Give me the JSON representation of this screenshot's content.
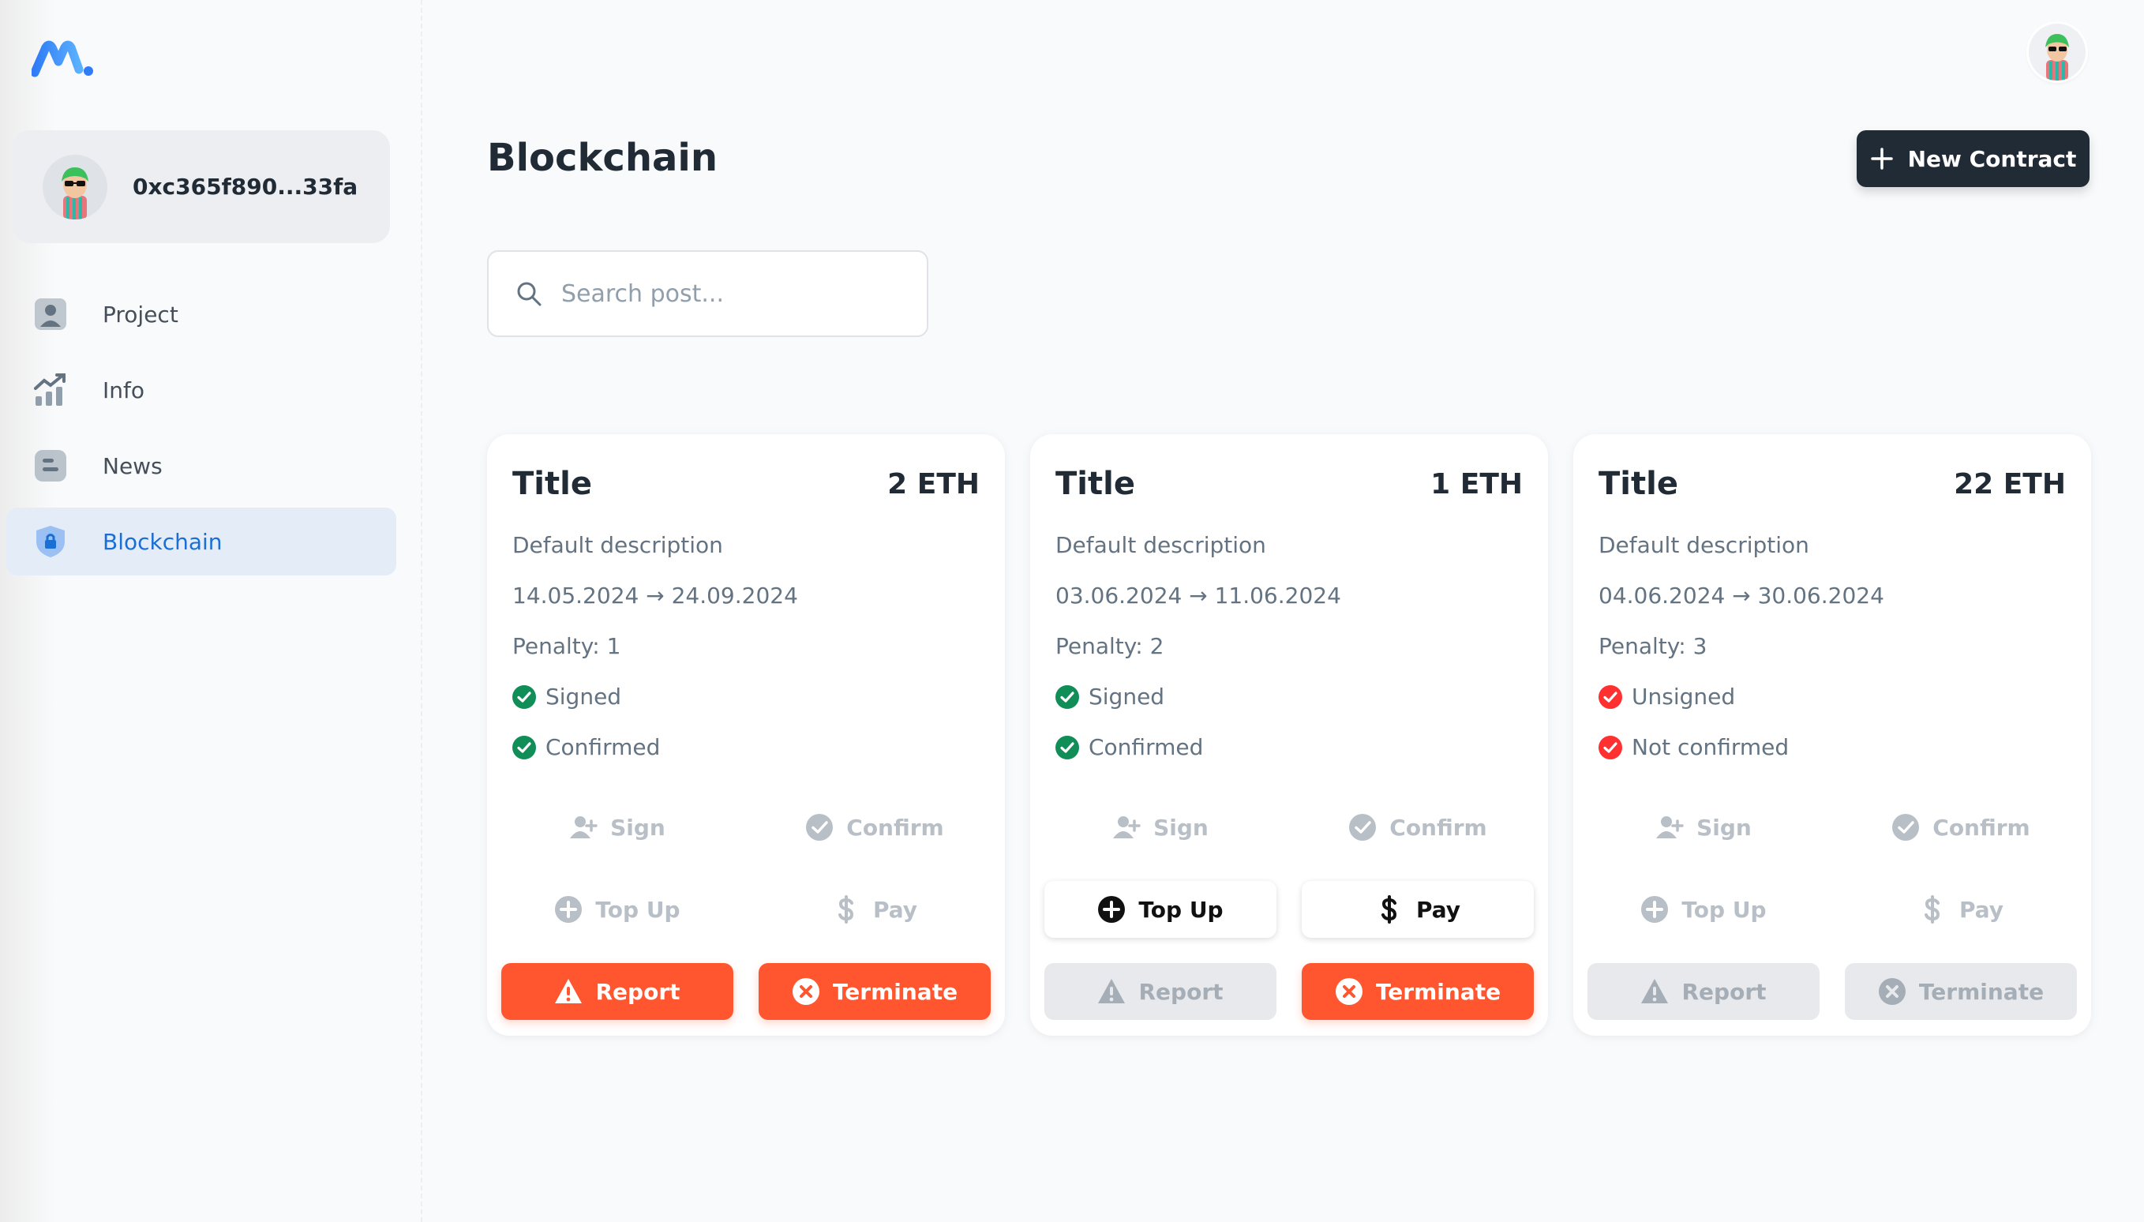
{
  "sidebar": {
    "account": {
      "address": "0xc365f890...33fa"
    },
    "nav": [
      {
        "label": "Project",
        "icon": "user-square-icon",
        "active": false
      },
      {
        "label": "Info",
        "icon": "chart-trend-icon",
        "active": false
      },
      {
        "label": "News",
        "icon": "blog-icon",
        "active": false
      },
      {
        "label": "Blockchain",
        "icon": "shield-lock-icon",
        "active": true
      }
    ]
  },
  "header": {
    "title": "Blockchain",
    "new_button": "New Contract"
  },
  "search": {
    "placeholder": "Search post..."
  },
  "colors": {
    "accent": "#1a6fd4",
    "danger": "#ff5630",
    "success": "#118d57",
    "error": "#ff3030",
    "dark": "#212b36"
  },
  "cards": [
    {
      "title": "Title",
      "price": "2 ETH",
      "description": "Default description",
      "dates": "14.05.2024 → 24.09.2024",
      "penalty": "Penalty: 1",
      "signed": "Signed",
      "signed_ok": true,
      "confirmed": "Confirmed",
      "confirmed_ok": true,
      "buttons": {
        "sign": "Sign",
        "confirm": "Confirm",
        "topup": "Top Up",
        "pay": "Pay",
        "report": "Report",
        "terminate": "Terminate"
      }
    },
    {
      "title": "Title",
      "price": "1 ETH",
      "description": "Default description",
      "dates": "03.06.2024 → 11.06.2024",
      "penalty": "Penalty: 2",
      "signed": "Signed",
      "signed_ok": true,
      "confirmed": "Confirmed",
      "confirmed_ok": true,
      "buttons": {
        "sign": "Sign",
        "confirm": "Confirm",
        "topup": "Top Up",
        "pay": "Pay",
        "report": "Report",
        "terminate": "Terminate"
      }
    },
    {
      "title": "Title",
      "price": "22 ETH",
      "description": "Default description",
      "dates": "04.06.2024 → 30.06.2024",
      "penalty": "Penalty: 3",
      "signed": "Unsigned",
      "signed_ok": false,
      "confirmed": "Not confirmed",
      "confirmed_ok": false,
      "buttons": {
        "sign": "Sign",
        "confirm": "Confirm",
        "topup": "Top Up",
        "pay": "Pay",
        "report": "Report",
        "terminate": "Terminate"
      }
    }
  ]
}
